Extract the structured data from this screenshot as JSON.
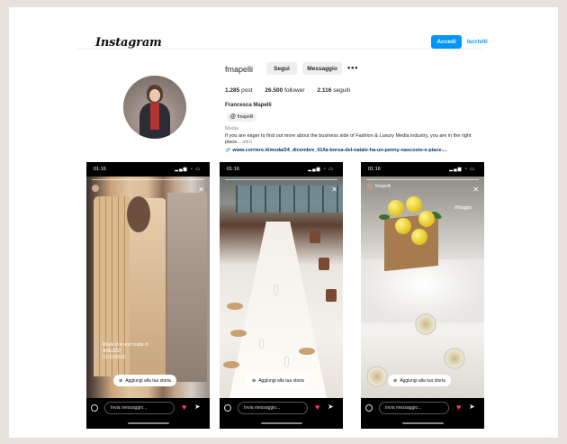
{
  "header": {
    "logo": "Instagram",
    "login_label": "Accedi",
    "signup_label": "Iscriviti"
  },
  "profile": {
    "username": "fmapelli",
    "follow_label": "Segui",
    "message_label": "Messaggio",
    "more_label": "•••",
    "stats": {
      "posts_value": "1.285",
      "posts_label": "post",
      "followers_value": "26.500",
      "followers_label": "follower",
      "following_value": "2.116",
      "following_label": "seguiti"
    },
    "full_name": "Francesca Mapelli",
    "threads_handle": "fmapelli",
    "category": "Media",
    "bio": "If you are eager to find out more about the business side of Fashion & Luxury Media industry, you are in the right place...",
    "bio_more": "altro",
    "link": "www.corriere.it/moda/24_dicembre_01/la-borsa-del-natale-ha-un-penny-nascosto-e-piace-..."
  },
  "stories": [
    {
      "time": "01:16",
      "signal": "▂▄▆ ◔ ▭",
      "caption_line1": "Made in ♥ and made in",
      "caption_line2": "AREZZO",
      "caption_line3": "01/12/2023",
      "add_story_label": "Aggiungi alla tua storia",
      "message_placeholder": "Invia messaggio..."
    },
    {
      "time": "01:16",
      "signal": "▂▄▆ ◔ ▭",
      "add_story_label": "Aggiungi alla tua storia",
      "message_placeholder": "Invia messaggio..."
    },
    {
      "time": "01:16",
      "signal": "▂▄▆ ◔ ▭",
      "user": "fmapelli",
      "location_tag": "#Maggio",
      "add_story_label": "Aggiungi alla tua storia",
      "message_placeholder": "Invia messaggio..."
    }
  ],
  "colors": {
    "brand_blue": "#0095f6",
    "heart_pink": "#ff3a6a",
    "backdrop": "#e7e2dc"
  }
}
